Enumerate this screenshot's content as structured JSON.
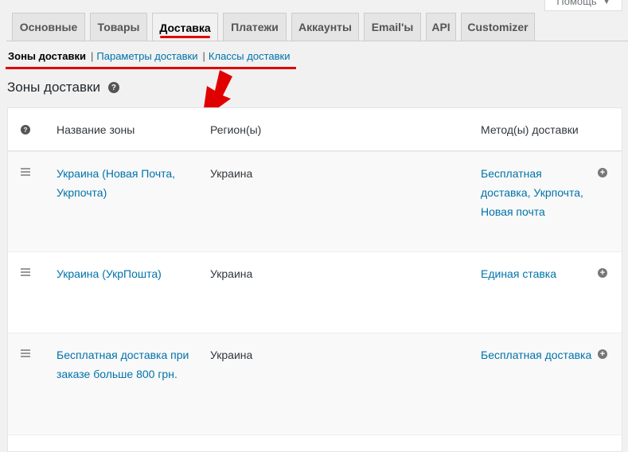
{
  "help_button": {
    "label": "Помощь",
    "icon": "caret-down-icon"
  },
  "tabs": [
    {
      "label": "Основные"
    },
    {
      "label": "Товары"
    },
    {
      "label": "Доставка",
      "active": true
    },
    {
      "label": "Платежи"
    },
    {
      "label": "Аккаунты"
    },
    {
      "label": "Email'ы"
    },
    {
      "label": "API"
    },
    {
      "label": "Customizer"
    }
  ],
  "subnav": {
    "current": "Зоны доставки",
    "sep": "|",
    "links": [
      "Параметры доставки",
      "Классы доставки"
    ]
  },
  "heading": {
    "title": "Зоны доставки",
    "help_icon": "?"
  },
  "table": {
    "headers": {
      "help": "?",
      "zone_name": "Название зоны",
      "regions": "Регион(ы)",
      "methods": "Метод(ы) доставки"
    },
    "rows": [
      {
        "zone": "Украина (Новая Почта, Укрпочта)",
        "region": "Украина",
        "methods": "Бесплатная доставка, Укрпочта, Новая почта"
      },
      {
        "zone": "Украина (УкрПошта)",
        "region": "Украина",
        "methods": "Единая ставка"
      },
      {
        "zone": "Бесплатная доставка при заказе больше 800 грн.",
        "region": "Украина",
        "methods": "Бесплатная доставка"
      }
    ],
    "add_icon": "+"
  },
  "colors": {
    "accent_red": "#e10000",
    "link_blue": "#0073aa",
    "background": "#f1f1f1"
  }
}
